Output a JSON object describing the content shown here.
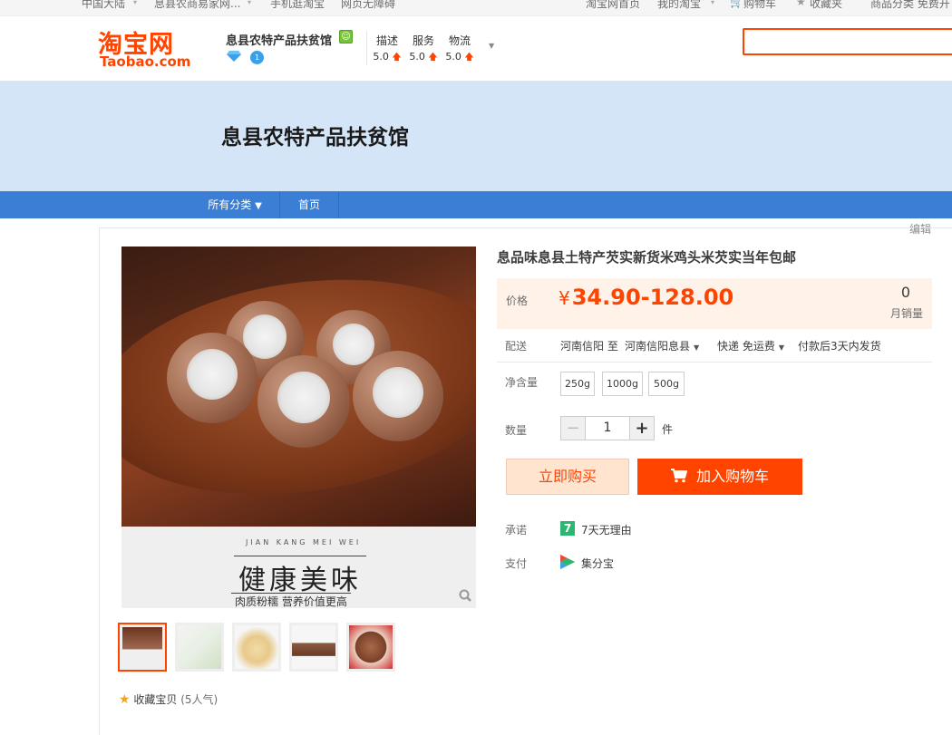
{
  "topbar": {
    "region": "中国大陆",
    "shop_link": "息县农商易家网...",
    "mobile": "手机逛淘宝",
    "accessible": "网页无障碍",
    "home": "淘宝网首页",
    "my_taobao": "我的淘宝",
    "cart": "购物车",
    "favorites": "收藏夹",
    "more": "商品分类 免费开"
  },
  "header": {
    "logo_cn": "淘宝网",
    "logo_en": "Taobao.com",
    "shop_name": "息县农特产品扶贫馆",
    "ratings": [
      {
        "label": "描述",
        "value": "5.0"
      },
      {
        "label": "服务",
        "value": "5.0"
      },
      {
        "label": "物流",
        "value": "5.0"
      }
    ],
    "search_value": ""
  },
  "banner": {
    "title": "息县农特产品扶贫馆"
  },
  "nav": {
    "all_categories": "所有分类",
    "home": "首页",
    "edit": "编辑"
  },
  "gallery": {
    "pinyin": "JIAN KANG MEI WEI",
    "caption": "健康美味",
    "subcaption": "肉质粉糯 营养价值更高",
    "favorite": "收藏宝贝",
    "popularity": "(5人气)"
  },
  "product": {
    "title": "息品味息县土特产芡实新货米鸡头米芡实当年包邮",
    "price_label": "价格",
    "currency": "¥",
    "price": "34.90-128.00",
    "sold_count": "0",
    "sold_label": "月销量",
    "ship_label": "配送",
    "ship_from": "河南信阳 至",
    "ship_to": "河南信阳息县",
    "ship_method": "快递 免运费",
    "ship_time": "付款后3天内发货",
    "weight_label": "净含量",
    "weights": [
      "250g",
      "1000g",
      "500g"
    ],
    "qty_label": "数量",
    "qty": "1",
    "qty_unit": "件",
    "buy_now": "立即购买",
    "add_cart": "加入购物车",
    "promise_label": "承诺",
    "promise_icon": "7",
    "promise_text": "7天无理由",
    "pay_label": "支付",
    "pay_text": "集分宝"
  },
  "colors": {
    "accent": "#ff4400",
    "nav": "#3a7fd5",
    "banner": "#d5e5f8",
    "price_bg": "#fff2e8"
  }
}
